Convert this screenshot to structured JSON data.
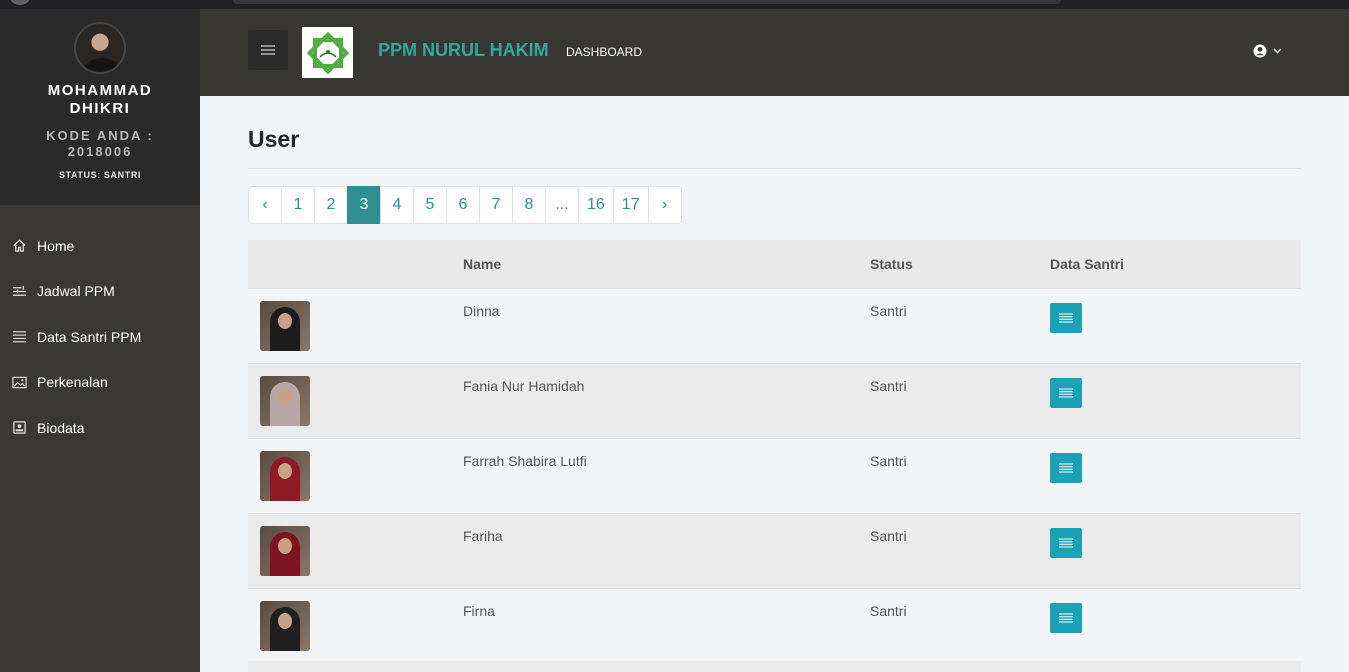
{
  "profile": {
    "name": "MOHAMMAD DHIKRI",
    "code": "KODE ANDA : 2018006",
    "status": "STATUS: SANTRI"
  },
  "sidebar": {
    "items": [
      {
        "label": "Home",
        "icon": "home-icon"
      },
      {
        "label": "Jadwal PPM",
        "icon": "schedule-icon"
      },
      {
        "label": "Data Santri PPM",
        "icon": "list-icon"
      },
      {
        "label": "Perkenalan",
        "icon": "image-icon"
      },
      {
        "label": "Biodata",
        "icon": "id-card-icon"
      }
    ]
  },
  "header": {
    "brand": "PPM NURUL HAKIM",
    "nav_label": "DASHBOARD",
    "menu_icon": "hamburger-icon",
    "user_icon": "user-circle-icon",
    "dropdown_icon": "chevron-down-icon"
  },
  "main": {
    "title": "User",
    "pagination": {
      "prev": "‹",
      "next": "›",
      "pages": [
        "1",
        "2",
        "3",
        "4",
        "5",
        "6",
        "7",
        "8",
        "...",
        "16",
        "17"
      ],
      "current": "3"
    },
    "table": {
      "headers": [
        "",
        "Name",
        "Status",
        "Data Santri"
      ],
      "rows": [
        {
          "name": "Dinna",
          "status": "Santri",
          "hijab_color": "#1c1c1c"
        },
        {
          "name": "Fania Nur Hamidah",
          "status": "Santri",
          "hijab_color": "#b9a6a6"
        },
        {
          "name": "Farrah Shabira Lutfi",
          "status": "Santri",
          "hijab_color": "#8e1b22"
        },
        {
          "name": "Fariha",
          "status": "Santri",
          "hijab_color": "#7d1420"
        },
        {
          "name": "Firna",
          "status": "Santri",
          "hijab_color": "#1f1f1f"
        }
      ]
    }
  },
  "colors": {
    "accent": "#2fa8a0",
    "active_page": "#2e8e91",
    "detail_button": "#1ba2b6",
    "sidebar_bg": "#3a3836",
    "header_bg": "#393734"
  }
}
